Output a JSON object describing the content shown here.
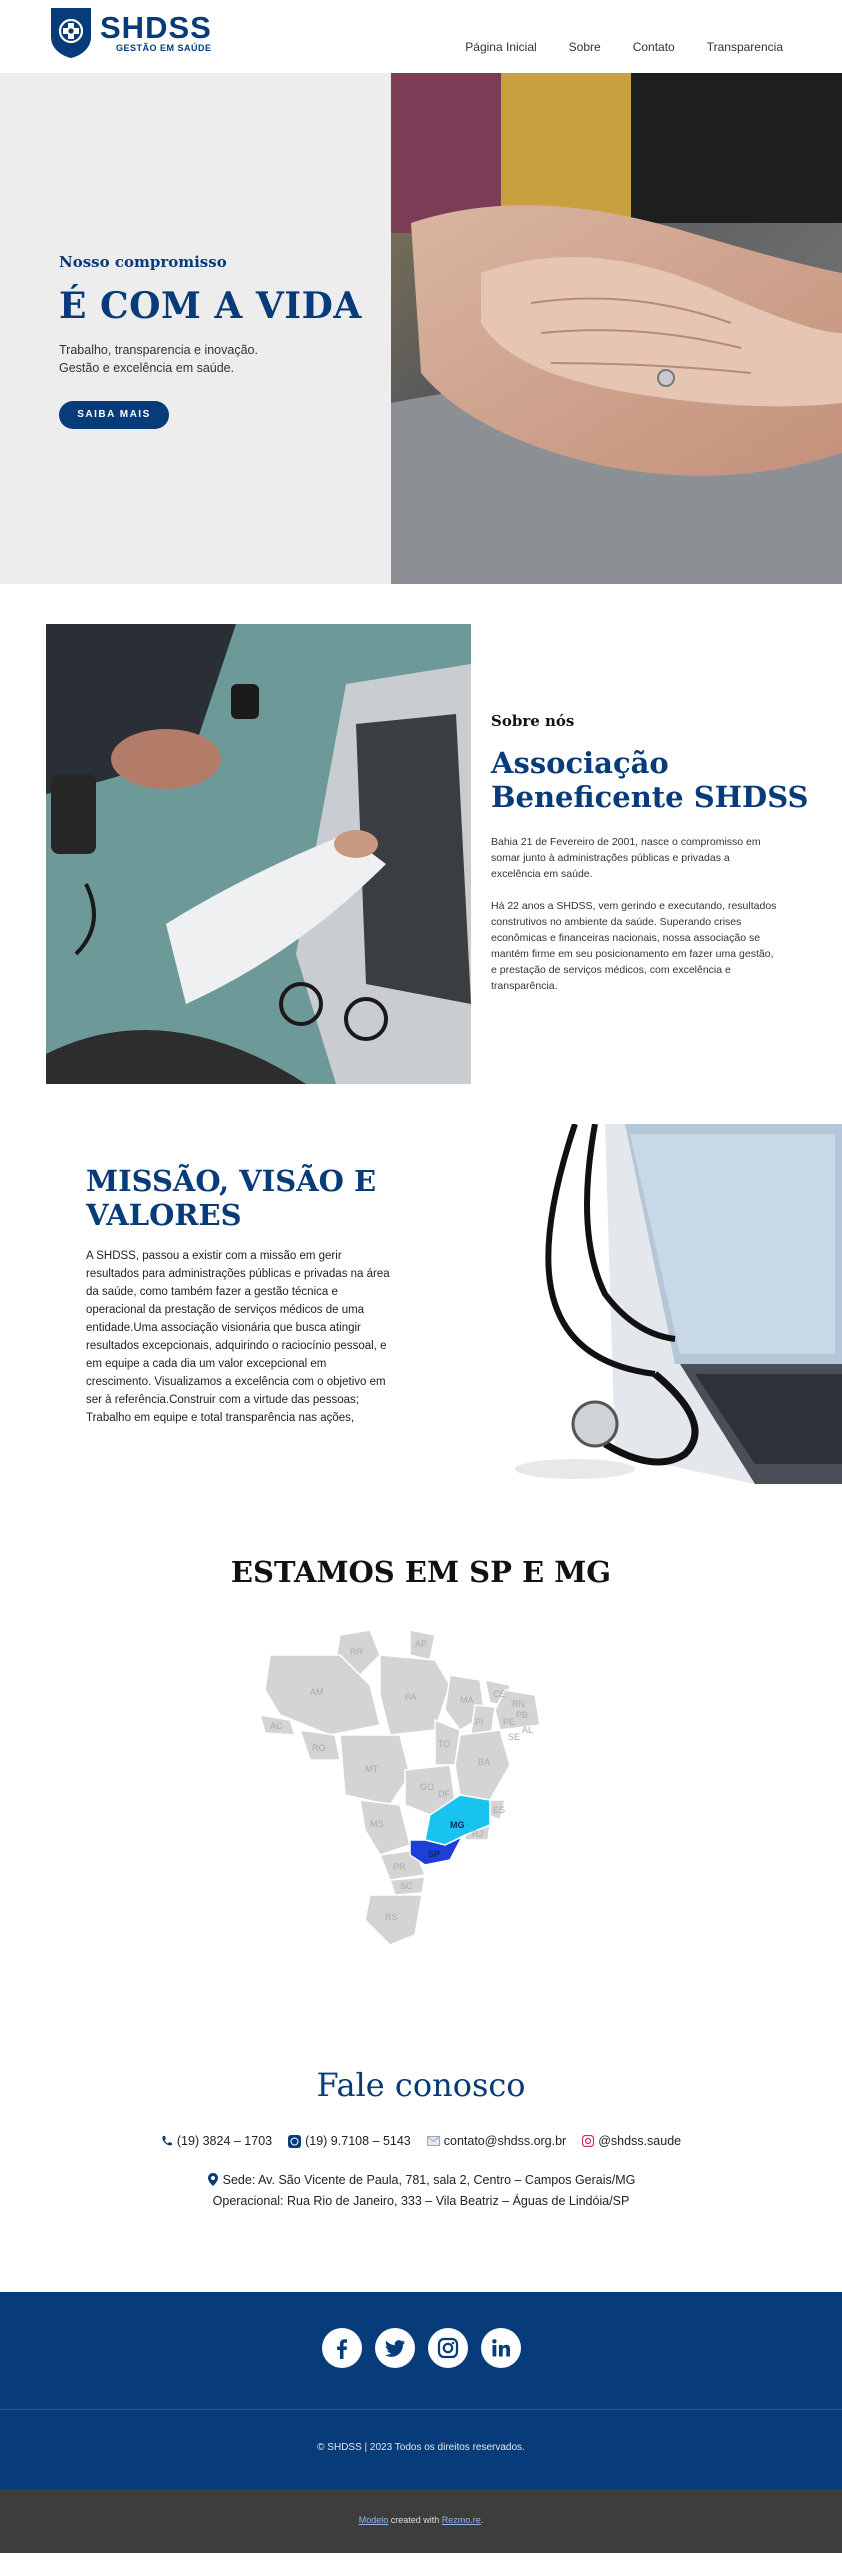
{
  "brand": {
    "name": "SHDSS",
    "tagline": "GESTÃO EM SAÚDE",
    "color": "#073b7a"
  },
  "nav": {
    "items": [
      "Página Inicial",
      "Sobre",
      "Contato",
      "Transparencia"
    ]
  },
  "hero": {
    "eyebrow": "Nosso compromisso",
    "title": "É COM A VIDA",
    "line1": "Trabalho, transparencia e inovação.",
    "line2": "Gestão e excelência em saúde.",
    "button": "SAIBA MAIS",
    "image": "elderly-holding-hands-photo"
  },
  "about": {
    "eyebrow": "Sobre nós",
    "title": "Associação Beneficente SHDSS",
    "p1": "Bahia 21 de Fevereiro de 2001, nasce o compromisso em somar junto à administrações públicas e privadas a excelência em saúde.",
    "p2": "Há 22 anos a SHDSS, vem gerindo e executando, resultados construtivos no ambiente da saúde. Superando crises econômicas e financeiras nacionais, nossa associação se mantém firme em seu posicionamento em fazer uma gestão, e prestação de serviços médicos, com excelência e transparência.",
    "image": "doctor-patient-laptop-photo"
  },
  "mission": {
    "title": "MISSÃO, VISÃO E VALORES",
    "text": "A SHDSS, passou a existir com a missão em gerir resultados para administrações públicas e privadas na área da saúde, como também fazer a gestão técnica e operacional da prestação de serviços médicos de uma entidade.Uma associação visionária que busca atingir resultados excepcionais, adquirindo o raciocínio pessoal, e em equipe a cada dia um valor excepcional em crescimento. Visualizamos a excelência com o objetivo em ser à referência.Construir com a virtude das pessoas; Trabalho em equipe e total transparência nas ações,",
    "image": "stethoscope-laptop-photo"
  },
  "states": {
    "title": "ESTAMOS EM SP E MG",
    "labels": {
      "RR": "RR",
      "AP": "AP",
      "AM": "AM",
      "PA": "PA",
      "MA": "MA",
      "CE": "CE",
      "RN": "RN",
      "PB": "PB",
      "PE": "PE",
      "AL": "AL",
      "SE": "SE",
      "PI": "PI",
      "AC": "AC",
      "RO": "RO",
      "TO": "TO",
      "BA": "BA",
      "MT": "MT",
      "GO": "GO",
      "DF": "DF",
      "MS": "MS",
      "MG": "MG",
      "ES": "ES",
      "SP": "SP",
      "RJ": "RJ",
      "PR": "PR",
      "SC": "SC",
      "RS": "RS"
    },
    "colors": {
      "inactive": "#d4d4d4",
      "mg": "#19c3ef",
      "sp": "#1d3fd8"
    }
  },
  "contact": {
    "title": "Fale conosco",
    "phone": "(19) 3824 – 1703",
    "whatsapp": "(19) 9.7108 – 5143",
    "email": "contato@shdss.org.br",
    "instagram": "@shdss.saude",
    "sede": "Sede: Av. São Vicente de Paula, 781, sala 2, Centro – Campos Gerais/MG",
    "operacional": "Operacional: Rua Rio de Janeiro, 333 – Vila Beatriz – Águas de Lindóia/SP"
  },
  "footer": {
    "social": [
      "facebook-icon",
      "twitter-icon",
      "instagram-icon",
      "linkedin-icon"
    ],
    "copyright": "© SHDSS | 2023 Todos os direitos reservados.",
    "credit_link1": "Modelo",
    "credit_mid": " created with ",
    "credit_link2": "Rezmo.re",
    "credit_end": "."
  }
}
